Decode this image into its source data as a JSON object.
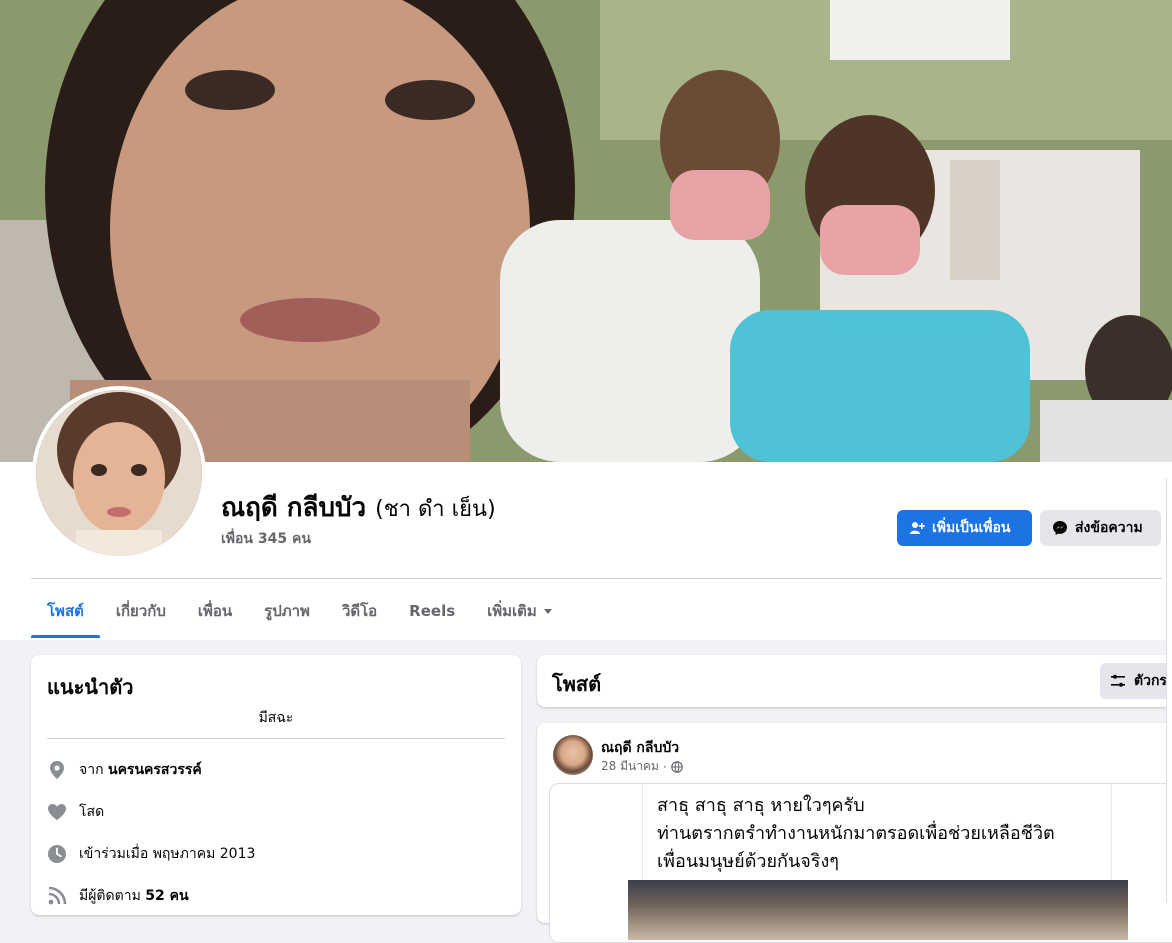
{
  "profile": {
    "name": "ณฤดี กลีบบัว",
    "alt_name": "(ชา ดำ เย็น)",
    "friends": "เพื่อน 345 คน"
  },
  "actions": {
    "add_friend": "เพิ่มเป็นเพื่อน",
    "message": "ส่งข้อความ"
  },
  "tabs": [
    {
      "label": "โพสต์",
      "active": true
    },
    {
      "label": "เกี่ยวกับ"
    },
    {
      "label": "เพื่อน"
    },
    {
      "label": "รูปภาพ"
    },
    {
      "label": "วิดีโอ"
    },
    {
      "label": "Reels"
    },
    {
      "label": "เพิ่มเติม"
    }
  ],
  "intro": {
    "title": "แนะนำตัว",
    "bio": "มีสฉะ",
    "hometown_prefix": "จาก",
    "hometown": "นครนครสวรรค์",
    "relationship": "โสด",
    "joined": "เข้าร่วมเมื่อ พฤษภาคม 2013",
    "followers_prefix": "มีผู้ติดตาม",
    "followers": "52 คน"
  },
  "posts": {
    "title": "โพสต์",
    "filter_label": "ตัวกรอง",
    "first": {
      "author": "ณฤดี กลีบบัว",
      "date": "28 มีนาคม",
      "separator": "·",
      "lines": [
        "สาธุ สาธุ สาธุ หายใวๆครับ",
        "ท่านตรากตรำทำงานหนักมาตรอดเพื่อช่วยเหลือชีวิต",
        "เพื่อนมนุษย์ด้วยกันจริงๆ"
      ]
    }
  },
  "colors": {
    "accent": "#1b74e4",
    "page_bg": "#f0f2f5",
    "secondary_btn": "#e4e6eb",
    "muted_text": "#65676b"
  },
  "icons": {
    "add_friend": "person-plus-icon",
    "message": "messenger-icon",
    "more": "caret-down-icon",
    "filter": "sliders-icon",
    "location": "map-pin-icon",
    "relationship": "heart-icon",
    "joined": "clock-icon",
    "followers": "rss-icon",
    "audience": "globe-icon"
  }
}
